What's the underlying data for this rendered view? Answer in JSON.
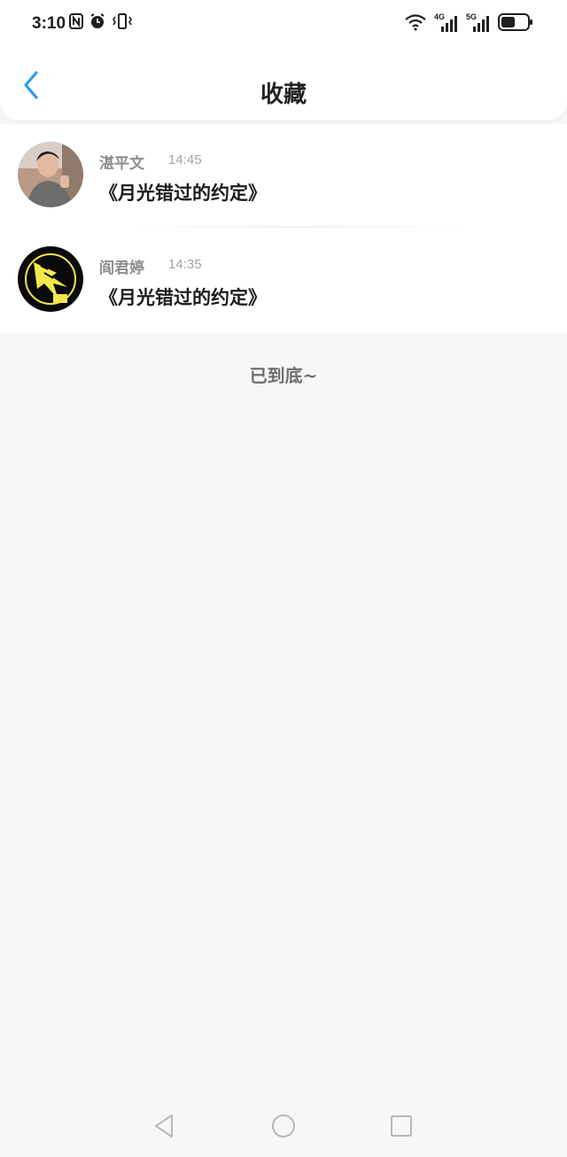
{
  "status_bar": {
    "time": "3:10",
    "left_icons": [
      "nfc-icon",
      "alarm-icon",
      "vibrate-icon"
    ],
    "right_icons": [
      "wifi-icon",
      "signal-4g-icon",
      "signal-5g-icon",
      "battery-icon"
    ],
    "net_4g": "4G",
    "net_5g": "5G"
  },
  "header": {
    "title": "收藏",
    "back_icon": "chevron-left-icon",
    "accent_color": "#2a9bf0"
  },
  "favorites": [
    {
      "username": "湛平文",
      "time": "14:45",
      "title": "《月光错过的约定》"
    },
    {
      "username": "阎君婷",
      "time": "14:35",
      "title": "《月光错过的约定》"
    }
  ],
  "end_text": "已到底~",
  "nav_bar": {
    "buttons": [
      "back-triangle-icon",
      "home-circle-icon",
      "recents-square-icon"
    ]
  }
}
